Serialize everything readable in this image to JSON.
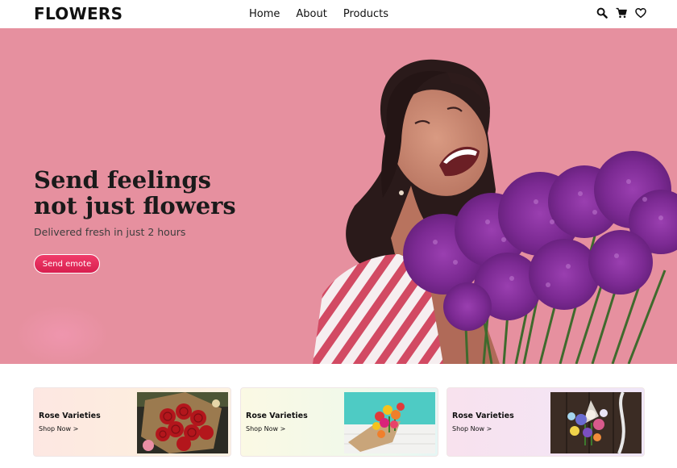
{
  "header": {
    "logo": "FLOWERS",
    "nav": [
      {
        "label": "Home"
      },
      {
        "label": "About"
      },
      {
        "label": "Products"
      }
    ],
    "icons": [
      "search-icon",
      "cart-icon",
      "heart-icon"
    ]
  },
  "hero": {
    "title_line1": "Send feelings",
    "title_line2": "not just flowers",
    "subtitle": "Delivered fresh in just 2 hours",
    "button_label": "Send emote",
    "background_color": "#e6909f",
    "button_color": "#e8305c"
  },
  "cards": [
    {
      "title": "Rose Varieties",
      "link": "Shop Now >",
      "image": "red-roses-bouquet"
    },
    {
      "title": "Rose Varieties",
      "link": "Shop Now >",
      "image": "tulip-bouquet-on-wood"
    },
    {
      "title": "Rose Varieties",
      "link": "Shop Now >",
      "image": "mixed-bouquet-on-dark-wood"
    }
  ]
}
